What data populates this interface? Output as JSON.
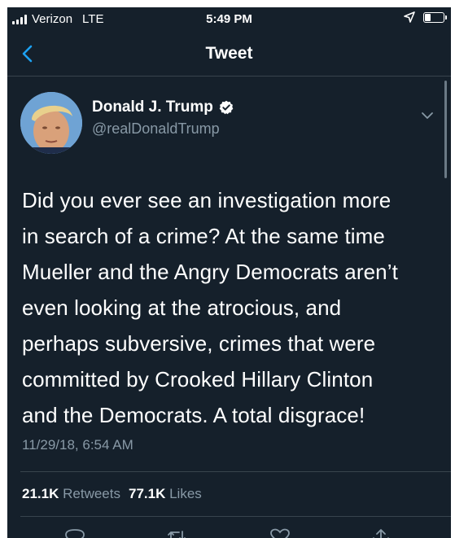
{
  "status_bar": {
    "carrier": "Verizon",
    "network": "LTE",
    "time": "5:49 PM",
    "battery_level": 0.3
  },
  "nav": {
    "title": "Tweet"
  },
  "tweet": {
    "author_name": "Donald J. Trump",
    "handle": "@realDonaldTrump",
    "verified": true,
    "text_lines": [
      "Did you ever see an investigation more",
      "in search of a crime? At the same time",
      "Mueller and the Angry Democrats aren’t",
      "even looking at the atrocious, and",
      "perhaps subversive, crimes that were",
      "committed by Crooked Hillary Clinton",
      "and the Democrats. A total disgrace!"
    ],
    "timestamp": "11/29/18, 6:54 AM",
    "retweets_count": "21.1K",
    "retweets_label": "Retweets",
    "likes_count": "77.1K",
    "likes_label": "Likes"
  },
  "icons": {
    "signal": "signal-bars-icon",
    "location": "location-arrow-icon",
    "battery": "battery-icon",
    "back": "chevron-left-icon",
    "verified": "verified-badge-icon",
    "caret": "chevron-down-icon",
    "reply": "reply-icon",
    "retweet": "retweet-icon",
    "like": "heart-icon",
    "share": "share-icon"
  },
  "colors": {
    "background": "#15202b",
    "accent": "#1da1f2",
    "secondary_text": "#8899a6",
    "divider": "#38444d"
  }
}
